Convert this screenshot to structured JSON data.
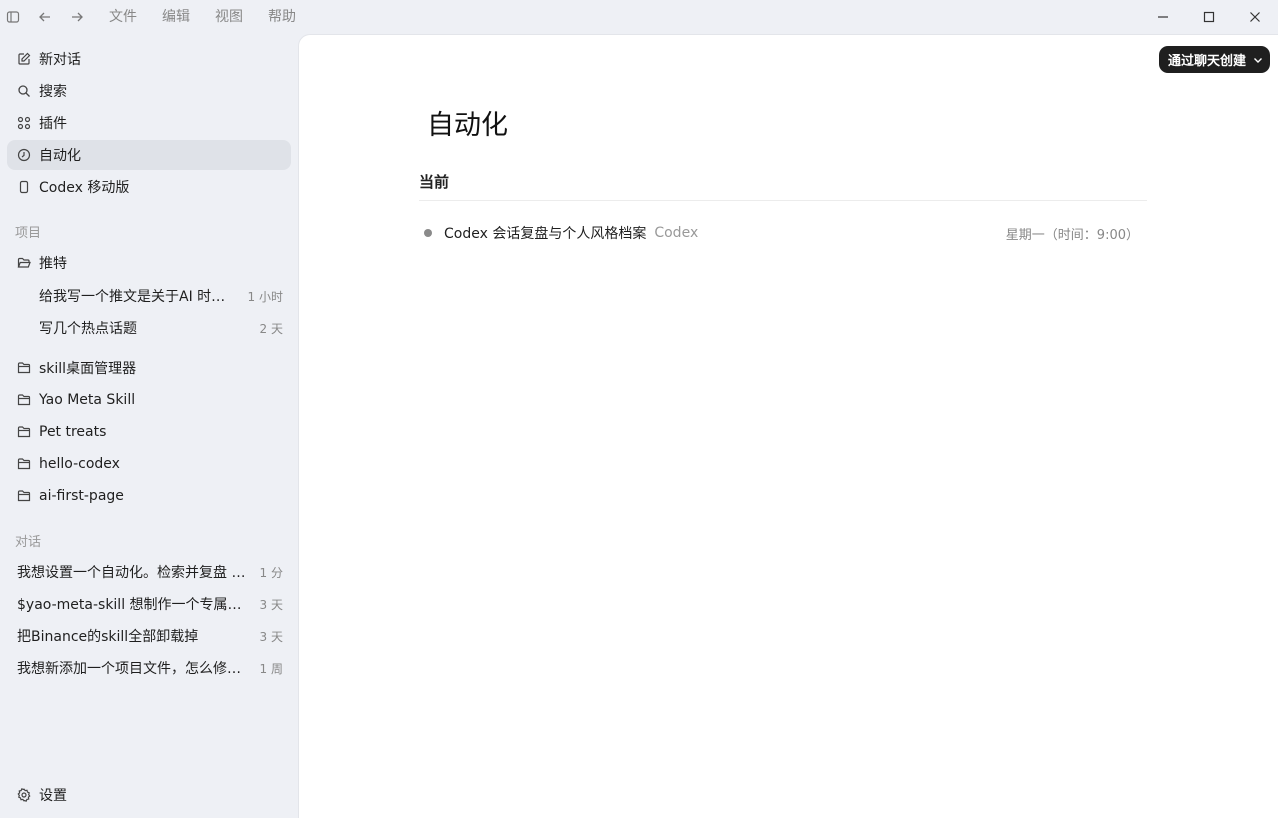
{
  "menu": {
    "file": "文件",
    "edit": "编辑",
    "view": "视图",
    "help": "帮助"
  },
  "sidebar": {
    "nav": [
      {
        "label": "新对话",
        "icon": "edit-icon"
      },
      {
        "label": "搜索",
        "icon": "search-icon"
      },
      {
        "label": "插件",
        "icon": "grid-icon"
      },
      {
        "label": "自动化",
        "icon": "clock-icon"
      },
      {
        "label": "Codex 移动版",
        "icon": "phone-icon"
      }
    ],
    "projects_label": "项目",
    "projects": [
      {
        "name": "推特",
        "threads": [
          {
            "title": "给我写一个推文是关于AI 时代...",
            "time": "1 小时"
          },
          {
            "title": "写几个热点话题",
            "time": "2 天"
          }
        ]
      },
      {
        "name": "skill桌面管理器"
      },
      {
        "name": "Yao Meta Skill"
      },
      {
        "name": "Pet treats"
      },
      {
        "name": "hello-codex"
      },
      {
        "name": "ai-first-page"
      }
    ],
    "conversations_label": "对话",
    "conversations": [
      {
        "title": "我想设置一个自动化。检索并复盘 C...",
        "time": "1 分"
      },
      {
        "title": "$yao-meta-skill 想制作一个专属于我...",
        "time": "3 天"
      },
      {
        "title": "把Binance的skill全部卸载掉",
        "time": "3 天"
      },
      {
        "title": "我想新添加一个项目文件，怎么修改...",
        "time": "1 周"
      }
    ],
    "settings_label": "设置"
  },
  "main": {
    "create_button": "通过聊天创建",
    "title": "自动化",
    "section": "当前",
    "automations": [
      {
        "name": "Codex 会话复盘与个人风格档案",
        "source": "Codex",
        "schedule": "星期一（时间：9:00）"
      }
    ]
  }
}
